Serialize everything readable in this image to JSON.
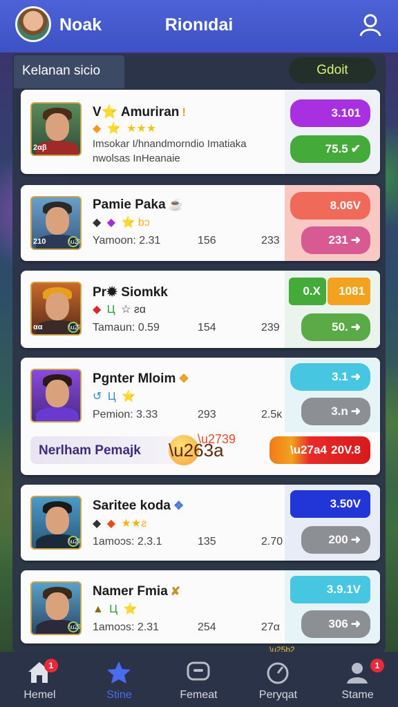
{
  "header": {
    "username": "Noak",
    "title": "Rionıdai"
  },
  "panel": {
    "section_label": "Kelanan sicio",
    "gold_button": "Gdoit"
  },
  "players": [
    {
      "name": "V⭐ Amuriran",
      "deco": "!",
      "badges": [
        "◆",
        "⭐",
        "★★★"
      ],
      "description": "Imsokar I/hnandmorndio Imatiaka nwolsas InHeanaie",
      "portrait_tag": "2αβ",
      "side_color": "#eef2f6",
      "pills": [
        {
          "value": "3.101",
          "color": "#a830e0",
          "arrow": ""
        },
        {
          "value": "75.5",
          "color": "#44aa3a",
          "arrow": "✔"
        }
      ]
    },
    {
      "name": "Pamie Paka",
      "deco": "☕",
      "badges": [
        "◆",
        "◆",
        "⭐ bɔ"
      ],
      "stats": [
        "Yamoon: 2.31",
        "156",
        "233"
      ],
      "portrait_tag": "210",
      "side_color": "#f8c8c2",
      "pills": [
        {
          "value": "8.06V",
          "color": "#f06a5a",
          "arrow": ""
        },
        {
          "value": "231",
          "color": "#d85a92",
          "arrow": "➜"
        }
      ]
    },
    {
      "name": "Pr✹ Siomkk",
      "deco": "",
      "badges": [
        "◆",
        "Ц",
        "☆ ƨɑ"
      ],
      "stats": [
        "Tamaun: 0.59",
        "154",
        "239"
      ],
      "portrait_tag": "αα",
      "side_color": "#eaf4ec",
      "pills": [
        {
          "value": "0.X",
          "color": "#44aa3a",
          "arrow": ""
        },
        {
          "value": "1081",
          "color": "#f2a21e",
          "arrow": ""
        },
        {
          "value": "50.",
          "color": "#5aaa48",
          "arrow": "➜"
        }
      ]
    },
    {
      "name": "Pgnter Mloim",
      "deco": "❖",
      "badges": [
        "↺",
        "Ц",
        "⭐"
      ],
      "stats": [
        "Pemion: 3.33",
        "293",
        "2.5κ"
      ],
      "portrait_tag": "",
      "side_color": "#e6f4f8",
      "feature_label": "Nerlham Pemajk",
      "pills": [
        {
          "value": "3.1",
          "color": "#46c6e0",
          "arrow": "➜"
        },
        {
          "value": "3.n",
          "color": "#8c8f94",
          "arrow": "➜"
        },
        {
          "value": "20V.8",
          "color": "#e82a2a",
          "arrow": ""
        }
      ]
    },
    {
      "name": "Saritee koda",
      "deco": "❖",
      "badges": [
        "◆",
        "◆",
        "★★ƨ"
      ],
      "stats": [
        "1amoɔs: 2.3.1",
        "135",
        "2.70"
      ],
      "portrait_tag": "",
      "side_color": "#e8ecf6",
      "pills": [
        {
          "value": "3.50V",
          "color": "#2236d8",
          "arrow": ""
        },
        {
          "value": "200",
          "color": "#8c8f94",
          "arrow": "➜"
        }
      ]
    },
    {
      "name": "Namer Fmia",
      "deco": "✘",
      "badges": [
        "▲",
        "Ц",
        "⭐"
      ],
      "stats": [
        "1amoɔs: 2.31",
        "254",
        "27α"
      ],
      "portrait_tag": "",
      "side_color": "#e6f4f8",
      "pills": [
        {
          "value": "3.9.1V",
          "color": "#46c6e0",
          "arrow": ""
        },
        {
          "value": "306",
          "color": "#8c8f94",
          "arrow": "➜"
        }
      ]
    }
  ],
  "nav": [
    {
      "label": "Hemel",
      "icon": "home-icon",
      "badge": "1"
    },
    {
      "label": "Stine",
      "icon": "star-icon",
      "badge": ""
    },
    {
      "label": "Femeat",
      "icon": "chat-icon",
      "badge": ""
    },
    {
      "label": "Peryqat",
      "icon": "timer-icon",
      "badge": ""
    },
    {
      "label": "Stame",
      "icon": "user-icon",
      "badge": "1"
    }
  ]
}
